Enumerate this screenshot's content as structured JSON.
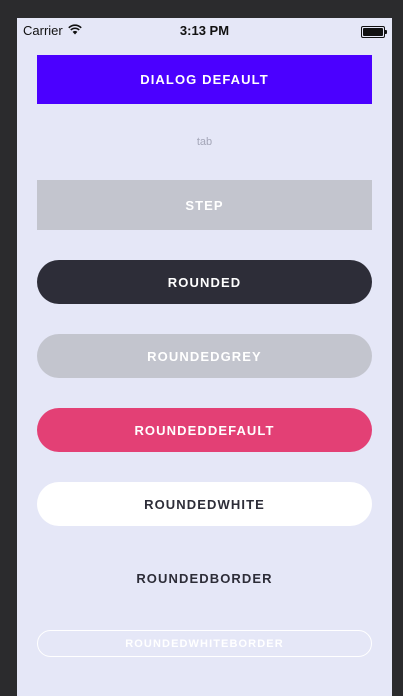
{
  "status_bar": {
    "carrier": "Carrier",
    "time": "3:13 PM",
    "wifi_icon": "wifi-icon",
    "battery_icon": "battery-icon"
  },
  "buttons": {
    "dialog_default": "DIALOG DEFAULT",
    "tab": "tab",
    "step": "STEP",
    "rounded": "ROUNDED",
    "rounded_grey": "ROUNDEDGREY",
    "rounded_default": "ROUNDEDDEFAULT",
    "rounded_white": "ROUNDEDWHITE",
    "rounded_border": "ROUNDEDBORDER",
    "rounded_white_border": "ROUNDEDWHITEBORDER"
  },
  "colors": {
    "primary": "#4b00ff",
    "dark": "#2d2d38",
    "grey": "#c3c5ce",
    "pink": "#e34075",
    "background": "#e5e7f7"
  }
}
